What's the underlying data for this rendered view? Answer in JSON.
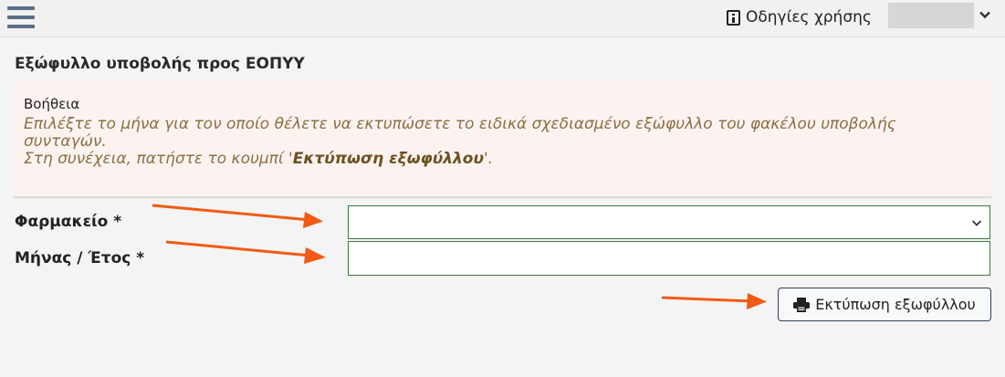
{
  "header": {
    "help_label": "Οδηγίες χρήσης",
    "menu_icon": "hamburger-icon",
    "info_icon": "info-book-icon",
    "dropdown_icon": "chevron-down-icon"
  },
  "page": {
    "title": "Εξώφυλλο υποβολής προς ΕΟΠΥΥ"
  },
  "help_panel": {
    "title": "Βοήθεια",
    "line1": "Επιλέξτε το μήνα για τον οποίο θέλετε να εκτυπώσετε το ειδικά σχεδιασμένο εξώφυλλο του φακέλου υποβολής συνταγών.",
    "line2_prefix": "Στη συνέχεια, πατήστε το κουμπί '",
    "line2_bold": "Εκτύπωση εξωφύλλου",
    "line2_suffix": "'."
  },
  "form": {
    "pharmacy_label": "Φαρμακείο *",
    "pharmacy_value": "",
    "month_year_label": "Μήνας / Έτος *",
    "month_year_value": ""
  },
  "actions": {
    "print_label": "Εκτύπωση εξωφύλλου",
    "print_icon": "printer-icon"
  },
  "colors": {
    "arrow": "#f05a14",
    "input_border": "#3a7a3a",
    "help_text": "#8b6f42",
    "help_bg": "#fcf3f1"
  }
}
